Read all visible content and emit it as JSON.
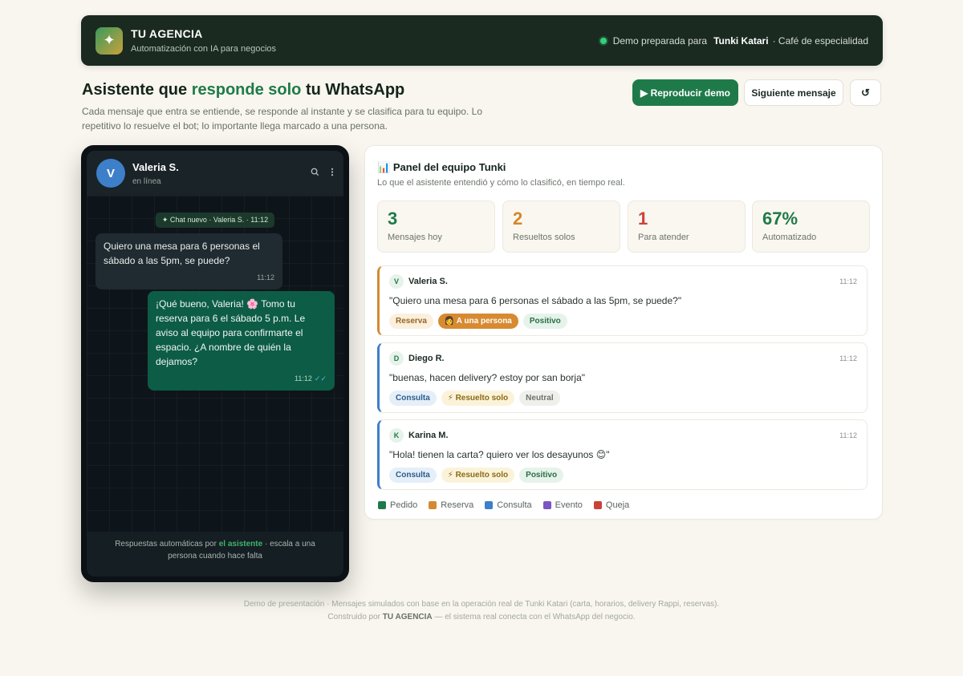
{
  "header": {
    "logo_glyph": "✦",
    "brand_name": "TU AGENCIA",
    "brand_subtitle": "Automatización con IA para negocios",
    "demo_label": "Demo preparada para",
    "client_name": "Tunki Katari",
    "client_type": "· Café de especialidad"
  },
  "hero": {
    "title_before": "Asistente que ",
    "title_accent": "responde solo",
    "title_after": " tu WhatsApp",
    "description": "Cada mensaje que entra se entiende, se responde al instante y se clasifica para tu equipo. Lo repetitivo lo resuelve el bot; lo importante llega marcado a una persona."
  },
  "toolbar": {
    "play_label": "▶ Reproducir demo",
    "next_label": "Siguiente mensaje",
    "reset_label": "↺"
  },
  "chat": {
    "avatar_letter": "V",
    "contact_name": "Valeria S.",
    "contact_status": "en línea",
    "system_notice": "✦ Chat nuevo · Valeria S. · 11:12",
    "incoming_text": "Quiero una mesa para 6 personas el sábado a las 5pm, se puede?",
    "incoming_time": "11:12",
    "outgoing_text": "¡Qué bueno, Valeria! 🌸 Tomo tu reserva para 6 el sábado 5 p.m. Le aviso al equipo para confirmarte el espacio. ¿A nombre de quién la dejamos?",
    "outgoing_time": "11:12",
    "outgoing_ticks": "✓✓",
    "footer_before": "Respuestas automáticas por ",
    "footer_accent": "el asistente",
    "footer_after": " · escala a una persona cuando hace falta"
  },
  "panel": {
    "icon": "📊",
    "title": "Panel del equipo Tunki",
    "subtitle": "Lo que el asistente entendió y cómo lo clasificó, en tiempo real.",
    "stats": [
      {
        "value": "3",
        "label": "Mensajes hoy",
        "color": "#1f7a4a"
      },
      {
        "value": "2",
        "label": "Resueltos solos",
        "color": "#d4862c"
      },
      {
        "value": "1",
        "label": "Para atender",
        "color": "#c9423a"
      },
      {
        "value": "67%",
        "label": "Automatizado",
        "color": "#1f7a4a"
      }
    ],
    "messages": [
      {
        "initial": "V",
        "name": "Valeria S.",
        "time": "11:12",
        "text": "\"Quiero una mesa para 6 personas el sábado a las 5pm, se puede?\"",
        "tags": [
          "Reserva",
          "👩 A una persona",
          "Positivo"
        ],
        "border_color": "#d48a32"
      },
      {
        "initial": "D",
        "name": "Diego R.",
        "time": "11:12",
        "text": "\"buenas, hacen delivery? estoy por san borja\"",
        "tags": [
          "Consulta",
          "⚡ Resuelto solo",
          "Neutral"
        ],
        "border_color": "#3d7fc8"
      },
      {
        "initial": "K",
        "name": "Karina M.",
        "time": "11:12",
        "text": "\"Hola! tienen la carta? quiero ver los desayunos 😊\"",
        "tags": [
          "Consulta",
          "⚡ Resuelto solo",
          "Positivo"
        ],
        "border_color": "#3d7fc8"
      }
    ],
    "legend": [
      {
        "label": "Pedido",
        "color": "#1f7a4a"
      },
      {
        "label": "Reserva",
        "color": "#d48a32"
      },
      {
        "label": "Consulta",
        "color": "#3d7fc8"
      },
      {
        "label": "Evento",
        "color": "#7b55c4"
      },
      {
        "label": "Queja",
        "color": "#c9423a"
      }
    ]
  },
  "footer": {
    "line1": "Demo de presentación · Mensajes simulados con base en la operación real de Tunki Katari (carta, horarios, delivery Rappi, reservas).",
    "line2_before": "Construido por ",
    "line2_brand": "TU AGENCIA",
    "line2_after": " — el sistema real conecta con el WhatsApp del negocio."
  }
}
